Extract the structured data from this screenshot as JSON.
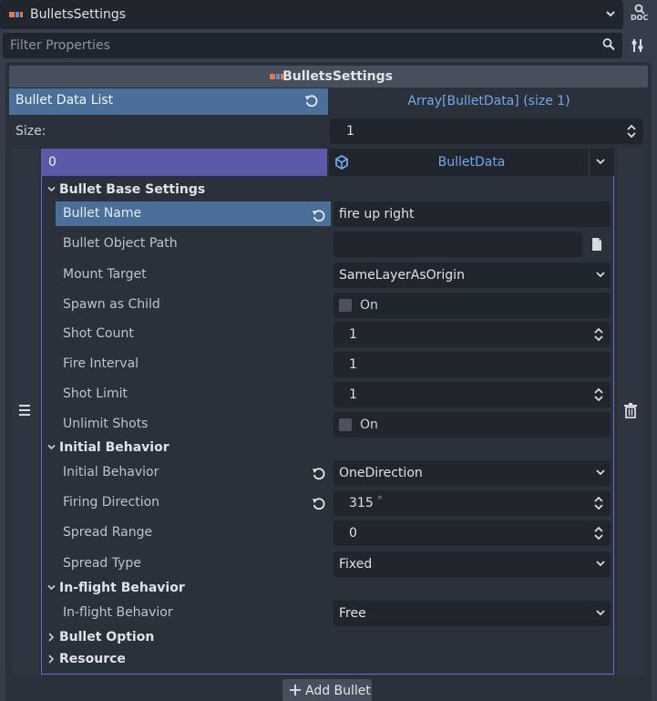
{
  "topbar": {
    "resource_title": "BulletsSettings",
    "doc_label": "DOC"
  },
  "filter": {
    "placeholder": "Filter Properties"
  },
  "header": {
    "title": "BulletsSettings"
  },
  "bullet_data_list": {
    "label": "Bullet Data List",
    "value": "Array[BulletData] (size 1)"
  },
  "size": {
    "label": "Size:",
    "value": "1"
  },
  "element": {
    "index": "0",
    "type": "BulletData"
  },
  "sections": {
    "base": "Bullet Base Settings",
    "initial": "Initial Behavior",
    "inflight": "In-flight Behavior",
    "option": "Bullet Option",
    "resource": "Resource"
  },
  "props": {
    "bullet_name": {
      "label": "Bullet Name",
      "value": "fire up right"
    },
    "bullet_object_path": {
      "label": "Bullet Object Path",
      "value": ""
    },
    "mount_target": {
      "label": "Mount Target",
      "value": "SameLayerAsOrigin"
    },
    "spawn_as_child": {
      "label": "Spawn as Child",
      "checkbox_text": "On"
    },
    "shot_count": {
      "label": "Shot Count",
      "value": "1"
    },
    "fire_interval": {
      "label": "Fire Interval",
      "value": "1"
    },
    "shot_limit": {
      "label": "Shot Limit",
      "value": "1"
    },
    "unlimit_shots": {
      "label": "Unlimit Shots",
      "checkbox_text": "On"
    },
    "initial_behavior": {
      "label": "Initial Behavior",
      "value": "OneDirection"
    },
    "firing_direction": {
      "label": "Firing Direction",
      "value": "315",
      "unit": "°"
    },
    "spread_range": {
      "label": "Spread Range",
      "value": "0"
    },
    "spread_type": {
      "label": "Spread Type",
      "value": "Fixed"
    },
    "inflight_behavior": {
      "label": "In-flight Behavior",
      "value": "Free"
    }
  },
  "add_button": {
    "label": "Add Bullet"
  },
  "colors": {
    "accent_blue": "#4a6f98",
    "index_purple": "#5a5aa8",
    "link_blue": "#74a7ea"
  }
}
